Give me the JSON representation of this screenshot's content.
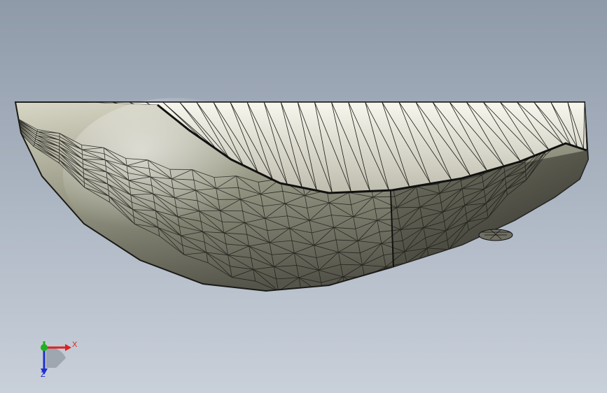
{
  "viewport": {
    "background_top": "#8f9aa9",
    "background_bottom": "#c9d0da"
  },
  "model": {
    "description_icon": "triangulated-mesh-bowl",
    "fill_light": "#f4f2e4",
    "fill_mid": "#a9a996",
    "fill_dark": "#3a3a30",
    "edge_color": "#111111"
  },
  "triad": {
    "x_label": "X",
    "z_label": "Z",
    "x_color": "#e02020",
    "y_color": "#20b020",
    "z_color": "#1e2fd0"
  }
}
